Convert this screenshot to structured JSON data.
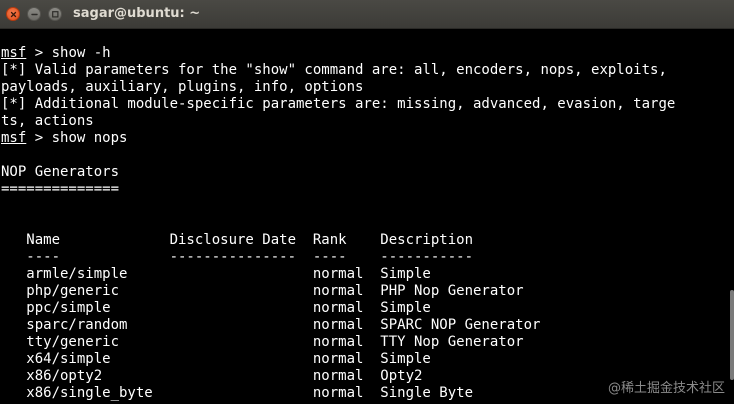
{
  "window": {
    "title": "sagar@ubuntu: ~"
  },
  "terminal": {
    "prompt_label": "msf",
    "commands": {
      "show_help": " > show -h",
      "show_nops": " > show nops"
    },
    "output": {
      "help_line_1": "[*] Valid parameters for the \"show\" command are: all, encoders, nops, exploits,",
      "help_line_2": "payloads, auxiliary, plugins, info, options",
      "help_line_3": "[*] Additional module-specific parameters are: missing, advanced, evasion, targe",
      "help_line_4": "ts, actions"
    },
    "nop_section": {
      "heading": "NOP Generators",
      "underline": "==============",
      "header_row": "   Name             Disclosure Date  Rank    Description",
      "separator_row": "   ----             ---------------  ----    -----------",
      "columns": [
        "Name",
        "Disclosure Date",
        "Rank",
        "Description"
      ],
      "rows": [
        {
          "name": "armle/simple",
          "disclosure_date": "",
          "rank": "normal",
          "description": "Simple",
          "text": "   armle/simple                      normal  Simple"
        },
        {
          "name": "php/generic",
          "disclosure_date": "",
          "rank": "normal",
          "description": "PHP Nop Generator",
          "text": "   php/generic                       normal  PHP Nop Generator"
        },
        {
          "name": "ppc/simple",
          "disclosure_date": "",
          "rank": "normal",
          "description": "Simple",
          "text": "   ppc/simple                        normal  Simple"
        },
        {
          "name": "sparc/random",
          "disclosure_date": "",
          "rank": "normal",
          "description": "SPARC NOP Generator",
          "text": "   sparc/random                      normal  SPARC NOP Generator"
        },
        {
          "name": "tty/generic",
          "disclosure_date": "",
          "rank": "normal",
          "description": "TTY Nop Generator",
          "text": "   tty/generic                       normal  TTY Nop Generator"
        },
        {
          "name": "x64/simple",
          "disclosure_date": "",
          "rank": "normal",
          "description": "Simple",
          "text": "   x64/simple                        normal  Simple"
        },
        {
          "name": "x86/opty2",
          "disclosure_date": "",
          "rank": "normal",
          "description": "Opty2",
          "text": "   x86/opty2                         normal  Opty2"
        },
        {
          "name": "x86/single_byte",
          "disclosure_date": "",
          "rank": "normal",
          "description": "Single Byte",
          "text": "   x86/single_byte                   normal  Single Byte"
        }
      ]
    }
  },
  "watermark": "@稀土掘金技术社区",
  "icons": {
    "close": "close-icon",
    "minimize": "minimize-icon",
    "maximize": "maximize-icon"
  },
  "colors": {
    "background": "#000000",
    "text": "#ffffff",
    "titlebar": "#3c3b37",
    "close_button": "#df4a16"
  }
}
